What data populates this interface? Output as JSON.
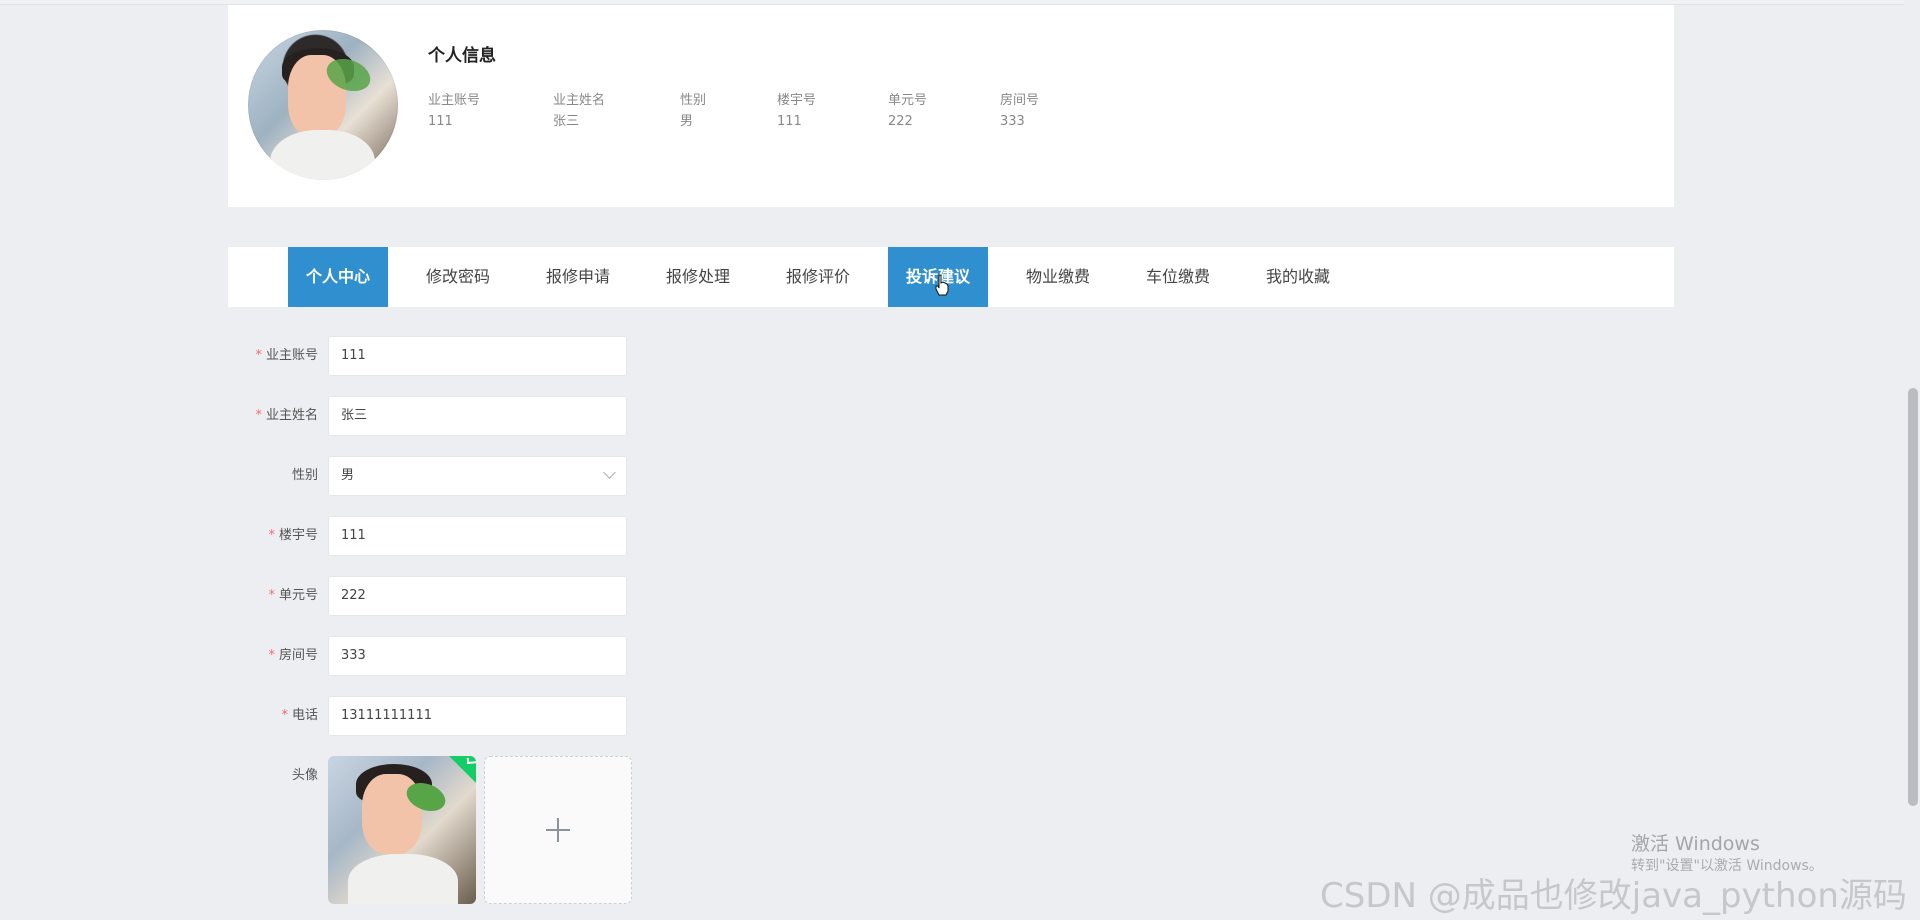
{
  "profile": {
    "title": "个人信息",
    "fields": [
      {
        "label": "业主账号",
        "value": "111"
      },
      {
        "label": "业主姓名",
        "value": "张三"
      },
      {
        "label": "性别",
        "value": "男"
      },
      {
        "label": "楼宇号",
        "value": "111"
      },
      {
        "label": "单元号",
        "value": "222"
      },
      {
        "label": "房间号",
        "value": "333"
      }
    ]
  },
  "tabs": [
    {
      "label": "个人中心",
      "active": true
    },
    {
      "label": "修改密码",
      "active": false
    },
    {
      "label": "报修申请",
      "active": false
    },
    {
      "label": "报修处理",
      "active": false
    },
    {
      "label": "报修评价",
      "active": false
    },
    {
      "label": "投诉建议",
      "active": true
    },
    {
      "label": "物业缴费",
      "active": false
    },
    {
      "label": "车位缴费",
      "active": false
    },
    {
      "label": "我的收藏",
      "active": false
    }
  ],
  "form": {
    "required_mark": "*",
    "account": {
      "label": "业主账号",
      "value": "111",
      "required": true
    },
    "name": {
      "label": "业主姓名",
      "value": "张三",
      "required": true
    },
    "gender": {
      "label": "性别",
      "value": "男",
      "required": false
    },
    "building": {
      "label": "楼宇号",
      "value": "111",
      "required": true
    },
    "unit": {
      "label": "单元号",
      "value": "222",
      "required": true
    },
    "room": {
      "label": "房间号",
      "value": "333",
      "required": true
    },
    "phone": {
      "label": "电话",
      "value": "13111111111",
      "required": true
    },
    "avatar": {
      "label": "头像"
    }
  },
  "watermark": {
    "windows_title": "激活 Windows",
    "windows_sub": "转到\"设置\"以激活 Windows。",
    "csdn": "CSDN @成品也修改java_python源码"
  },
  "colors": {
    "accent": "#2f8fcf",
    "required": "#f56c6c",
    "success": "#13ce66"
  }
}
